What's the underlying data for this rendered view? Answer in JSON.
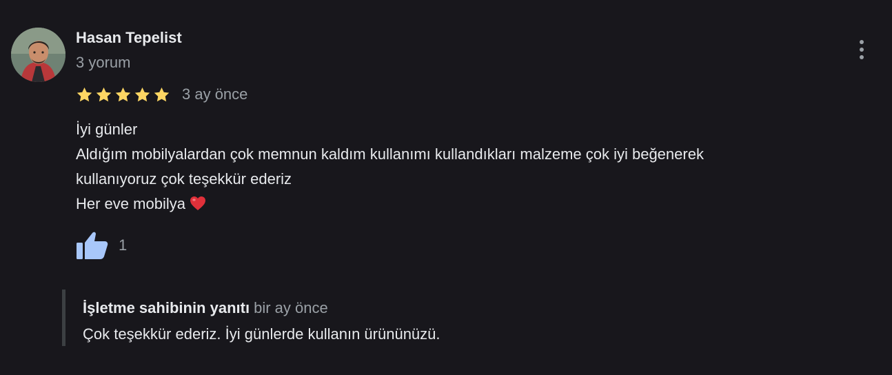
{
  "review": {
    "author_name": "Hasan Tepelist",
    "review_count": "3 yorum",
    "rating": 5,
    "date": "3 ay önce",
    "text_lines": [
      "İyi günler",
      "Aldığım mobilyalardan çok memnun kaldım kullanımı kullandıkları malzeme çok iyi beğenerek",
      "kullanıyoruz çok teşekkür ederiz",
      "Her eve mobilya"
    ],
    "likes": "1"
  },
  "owner_response": {
    "title": "İşletme sahibinin yanıtı",
    "date": "bir ay önce",
    "text": "Çok teşekkür ederiz. İyi günlerde kullanın ürününüzü."
  },
  "icons": {
    "avatar": "avatar-photo",
    "more": "more-vert-icon",
    "star": "star-icon",
    "heart": "heart-icon",
    "like": "thumb-up-icon"
  },
  "colors": {
    "background": "#18171c",
    "text_primary": "#e8eaed",
    "text_secondary": "#9aa0a6",
    "star": "#fdd663",
    "like": "#a8c7fa",
    "heart": "#e0303a",
    "response_border": "#3c4043"
  }
}
